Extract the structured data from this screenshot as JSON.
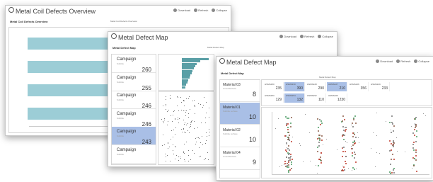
{
  "actions": [
    "Download",
    "Refresh",
    "Collapse"
  ],
  "back": {
    "title": "Metal Coil Defects Overview",
    "subtitle": "Metal Coil Defects Overview",
    "filter_label": "Metal Coil Defects Overview",
    "colors": {
      "teal": "#9ccdd6",
      "brown": "#8b5e49",
      "red": "#c0392b",
      "green": "#4b9b63",
      "blue": "#2e8fb5",
      "purple": "#7a2f8f"
    },
    "stack_rows": [
      [
        {
          "c": "teal",
          "w": 0.66
        },
        {
          "c": "brown",
          "w": 0.09
        },
        {
          "c": "green",
          "w": 0.1
        },
        {
          "c": "blue",
          "w": 0.06
        },
        {
          "c": "purple",
          "w": 0.09
        }
      ],
      [
        {
          "c": "teal",
          "w": 0.5
        },
        {
          "c": "brown",
          "w": 0.08
        },
        {
          "c": "red",
          "w": 0.18
        },
        {
          "c": "purple",
          "w": 0.24
        }
      ],
      [
        {
          "c": "teal",
          "w": 0.81
        },
        {
          "c": "brown",
          "w": 0.19
        }
      ],
      [
        {
          "c": "teal",
          "w": 0.69
        },
        {
          "c": "brown",
          "w": 0.31
        }
      ]
    ]
  },
  "mid": {
    "title": "Metal Defect Map",
    "subtitle": "Metal Defect Map",
    "filter_label": "Metal Defect Map",
    "campaigns": [
      {
        "name": "Campaign",
        "sub": "Subtitle",
        "value": "260",
        "selected": false
      },
      {
        "name": "Campaign",
        "sub": "Subtitle",
        "value": "255",
        "selected": false
      },
      {
        "name": "Campaign",
        "sub": "Subtitle",
        "value": "246",
        "selected": false
      },
      {
        "name": "Campaign",
        "sub": "Subtitle",
        "value": "246",
        "selected": false
      },
      {
        "name": "Campaign",
        "sub": "Subtitle",
        "value": "243",
        "selected": true
      },
      {
        "name": "Campaign",
        "sub": "Subtitle",
        "value": "",
        "selected": false
      }
    ],
    "bar_values": [
      0.95,
      0.66,
      0.52,
      0.48,
      0.43,
      0.38,
      0.34,
      0.3,
      0.27,
      0.23,
      0.19,
      0.15,
      0.12
    ]
  },
  "front": {
    "title": "Metal Defect Map",
    "subtitle": "Metal Defect Map",
    "filter_label": "Metal Defect Map",
    "materials": [
      {
        "name": "Material 03",
        "sub": "UnsubSurface",
        "value": "8",
        "selected": false
      },
      {
        "name": "Material 01",
        "sub": "Subtitle surface",
        "value": "10",
        "selected": true
      },
      {
        "name": "Material 02",
        "sub": "Subtitle surface",
        "value": "10",
        "selected": false
      },
      {
        "name": "Material 04",
        "sub": "UnsubSurface",
        "value": "9",
        "selected": false
      }
    ],
    "coils_row1": [
      {
        "name": "HSMS250",
        "value": "235",
        "selected": false
      },
      {
        "name": "HSMS230",
        "value": "390",
        "selected": true
      },
      {
        "name": "HSMS228",
        "value": "290",
        "selected": false
      },
      {
        "name": "HSMS227",
        "value": "210",
        "selected": true
      },
      {
        "name": "HSMS226",
        "value": "356",
        "selected": false
      },
      {
        "name": "HSMS229",
        "value": "233",
        "selected": false
      }
    ],
    "coils_row2": [
      {
        "name": "HSMS253",
        "value": "129",
        "selected": false
      },
      {
        "name": "HSMS254",
        "value": "132",
        "selected": true
      },
      {
        "name": "HSMS252",
        "value": "110",
        "selected": false
      },
      {
        "name": "HSMS260",
        "value": "1230",
        "selected": false
      }
    ]
  }
}
